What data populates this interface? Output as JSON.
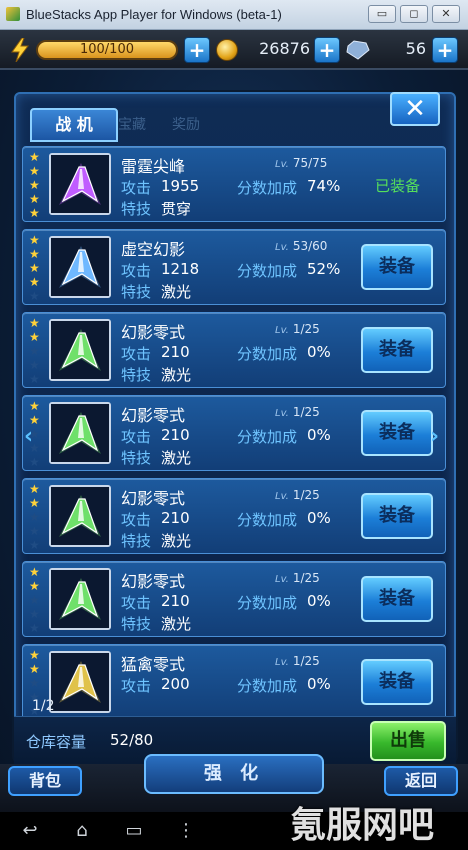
{
  "window": {
    "title": "BlueStacks App Player for Windows (beta-1)",
    "btn_min": "▭",
    "btn_max": "◻",
    "btn_close": "✕"
  },
  "hud": {
    "energy": "100/100",
    "coins": "26876",
    "gems": "56",
    "plus": "+"
  },
  "panel": {
    "tab": "战 机",
    "ghost_tab_1": "宝藏",
    "ghost_tab_2": "奖励",
    "close": "✕"
  },
  "labels": {
    "attack": "攻击",
    "bonus": "分数加成",
    "skill": "特技",
    "lv": "Lv."
  },
  "ships": [
    {
      "name": "雷霆尖峰",
      "level": "75/75",
      "attack": "1955",
      "bonus": "74%",
      "skill": "贯穿",
      "stars": 5,
      "action": "已装备",
      "equipped": true,
      "color": "#c05cff"
    },
    {
      "name": "虚空幻影",
      "level": "53/60",
      "attack": "1218",
      "bonus": "52%",
      "skill": "激光",
      "stars": 4,
      "action": "装备",
      "equipped": false,
      "color": "#6fb8ff"
    },
    {
      "name": "幻影零式",
      "level": "1/25",
      "attack": "210",
      "bonus": "0%",
      "skill": "激光",
      "stars": 2,
      "action": "装备",
      "equipped": false,
      "color": "#6fe06a"
    },
    {
      "name": "幻影零式",
      "level": "1/25",
      "attack": "210",
      "bonus": "0%",
      "skill": "激光",
      "stars": 2,
      "action": "装备",
      "equipped": false,
      "color": "#6fe06a"
    },
    {
      "name": "幻影零式",
      "level": "1/25",
      "attack": "210",
      "bonus": "0%",
      "skill": "激光",
      "stars": 2,
      "action": "装备",
      "equipped": false,
      "color": "#6fe06a"
    },
    {
      "name": "幻影零式",
      "level": "1/25",
      "attack": "210",
      "bonus": "0%",
      "skill": "激光",
      "stars": 2,
      "action": "装备",
      "equipped": false,
      "color": "#6fe06a"
    },
    {
      "name": "猛禽零式",
      "level": "1/25",
      "attack": "200",
      "bonus": "0%",
      "skill": "",
      "stars": 2,
      "action": "装备",
      "equipped": false,
      "color": "#e0c24a"
    }
  ],
  "page_indicator": "1/2",
  "storage": {
    "label": "仓库容量",
    "value": "52/80",
    "sell": "出售"
  },
  "bottom": {
    "bag": "背包",
    "enhance": "强 化",
    "back": "返回"
  },
  "nav": {
    "back": "↩",
    "home": "⌂",
    "recent": "▭",
    "menu": "⋮"
  },
  "watermark": "氪服网吧"
}
